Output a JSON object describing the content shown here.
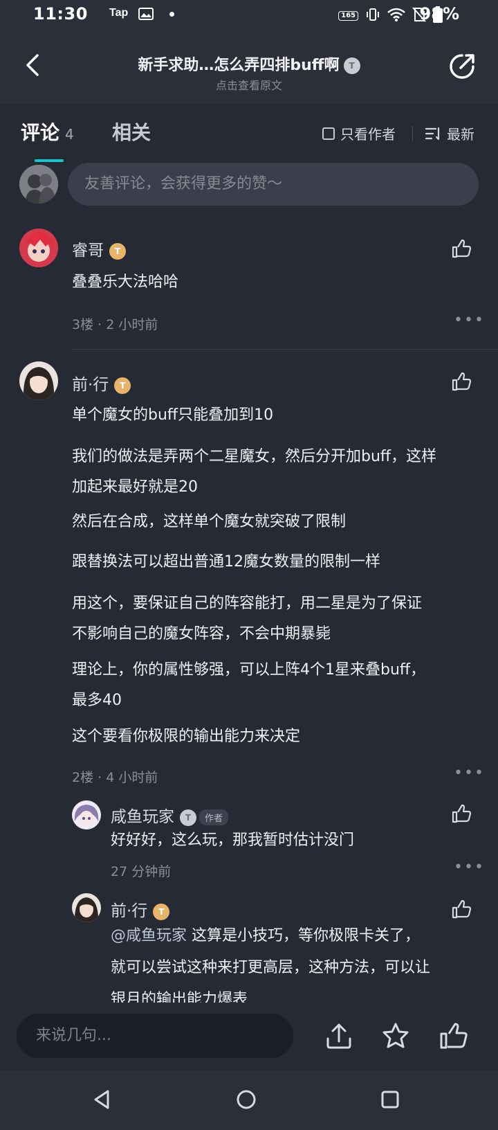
{
  "status_bar": {
    "time": "11:30",
    "tap_label": "Tap",
    "hz_label": "165",
    "battery": "98%"
  },
  "header": {
    "title": "新手求助…怎么弄四排buff啊",
    "title_badge": "T",
    "subtitle": "点击查看原文"
  },
  "tabs": {
    "comments_label": "评论",
    "comments_count": "4",
    "related_label": "相关",
    "only_author_label": "只看作者",
    "sort_label": "最新"
  },
  "comment_input": {
    "placeholder": "友善评论，会获得更多的赞～"
  },
  "comments": [
    {
      "username": "睿哥",
      "badge": "T",
      "lines": [
        "叠叠乐大法哈哈"
      ],
      "meta": "3楼 · 2 小时前"
    },
    {
      "username": "前·行",
      "badge": "T",
      "lines": [
        "单个魔女的buff只能叠加到10",
        "我们的做法是弄两个二星魔女，然后分开加buff，这样",
        "加起来最好就是20",
        "然后在合成，这样单个魔女就突破了限制",
        "跟替换法可以超出普通12魔女数量的限制一样",
        "用这个，要保证自己的阵容能打，用二星是为了保证",
        "不影响自己的魔女阵容，不会中期暴毙",
        "理论上，你的属性够强，可以上阵4个1星来叠buff，",
        "最多40",
        "这个要看你极限的输出能力来决定"
      ],
      "meta": "2楼 · 4 小时前",
      "replies": [
        {
          "username": "咸鱼玩家",
          "badge": "T",
          "author_tag": "作者",
          "text": "好好好，这么玩，那我暂时估计没门",
          "meta": "27 分钟前"
        },
        {
          "username": "前·行",
          "badge": "T",
          "mention": "@咸鱼玩家",
          "line1": "这算是小技巧，等你极限卡关了，",
          "line2": "就可以尝试这种来打更高层，这种方法，可以让",
          "line3": "银月的输出能力爆表"
        }
      ]
    }
  ],
  "bottom_bar": {
    "placeholder": "来说几句..."
  },
  "icons": {
    "back": "back-arrow-icon",
    "share": "share-icon",
    "like": "thumbs-up-icon",
    "more": "more-dots-icon",
    "upload": "upload-icon",
    "favorite": "star-icon",
    "sort": "sort-list-icon"
  },
  "colors": {
    "background": "#262a35",
    "accent": "#17c4c9",
    "level_badge": "#e8b46a"
  }
}
